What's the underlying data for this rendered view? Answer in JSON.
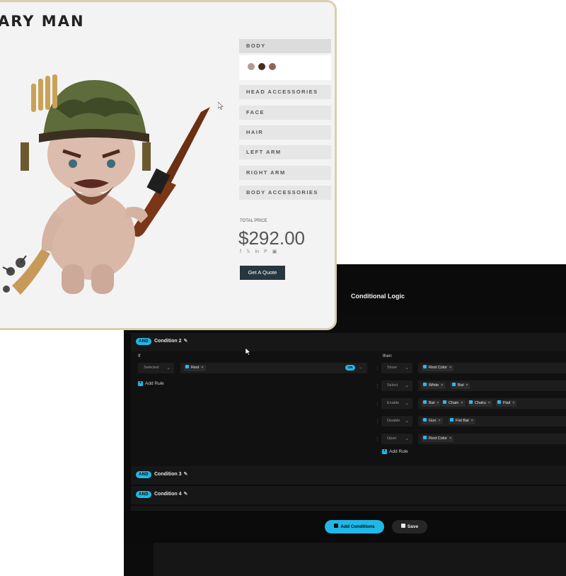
{
  "modal": {
    "title": "Conditional Logic",
    "if_label": "If",
    "then_label": "then",
    "rule_select_value": "Selected",
    "rule_tag": "Rest",
    "or_toggle": "OR",
    "add_rule_label": "Add Rule",
    "actions": [
      {
        "action": "Show",
        "tags": [
          "Rest Color"
        ]
      },
      {
        "action": "Select",
        "tags": [
          "White",
          "Bat"
        ]
      },
      {
        "action": "Enable",
        "tags": [
          "Bat",
          "Chain",
          "Chaku",
          "Flail"
        ]
      },
      {
        "action": "Disable",
        "tags": [
          "Gun",
          "Fist Bat"
        ]
      },
      {
        "action": "Open",
        "tags": [
          "Rest Color"
        ]
      }
    ],
    "conditions": [
      {
        "pill": "AND",
        "name": "Condition 2"
      },
      {
        "pill": "AND",
        "name": "Condition 3"
      },
      {
        "pill": "AND",
        "name": "Condition 4"
      }
    ],
    "add_conditions_label": "Add Conditions",
    "save_label": "Save"
  },
  "product": {
    "title": "ARY MAN",
    "options": [
      "BODY",
      "HEAD ACCESSORIES",
      "FACE",
      "HAIR",
      "LEFT ARM",
      "RIGHT ARM",
      "BODY ACCESSORIES"
    ],
    "swatch_colors": [
      "#b79a91",
      "#4a2c22",
      "#8e6557"
    ],
    "total_price_label": "TOTAL PRICE",
    "price": "$292.00",
    "social_icons": [
      "f",
      "𝕏",
      "in",
      "P",
      "▣"
    ],
    "quote_label": "Get A Quote"
  },
  "icons": {
    "pencil": "✎",
    "chevron": "⌄",
    "grip": "⋮⋮",
    "close": "×"
  }
}
